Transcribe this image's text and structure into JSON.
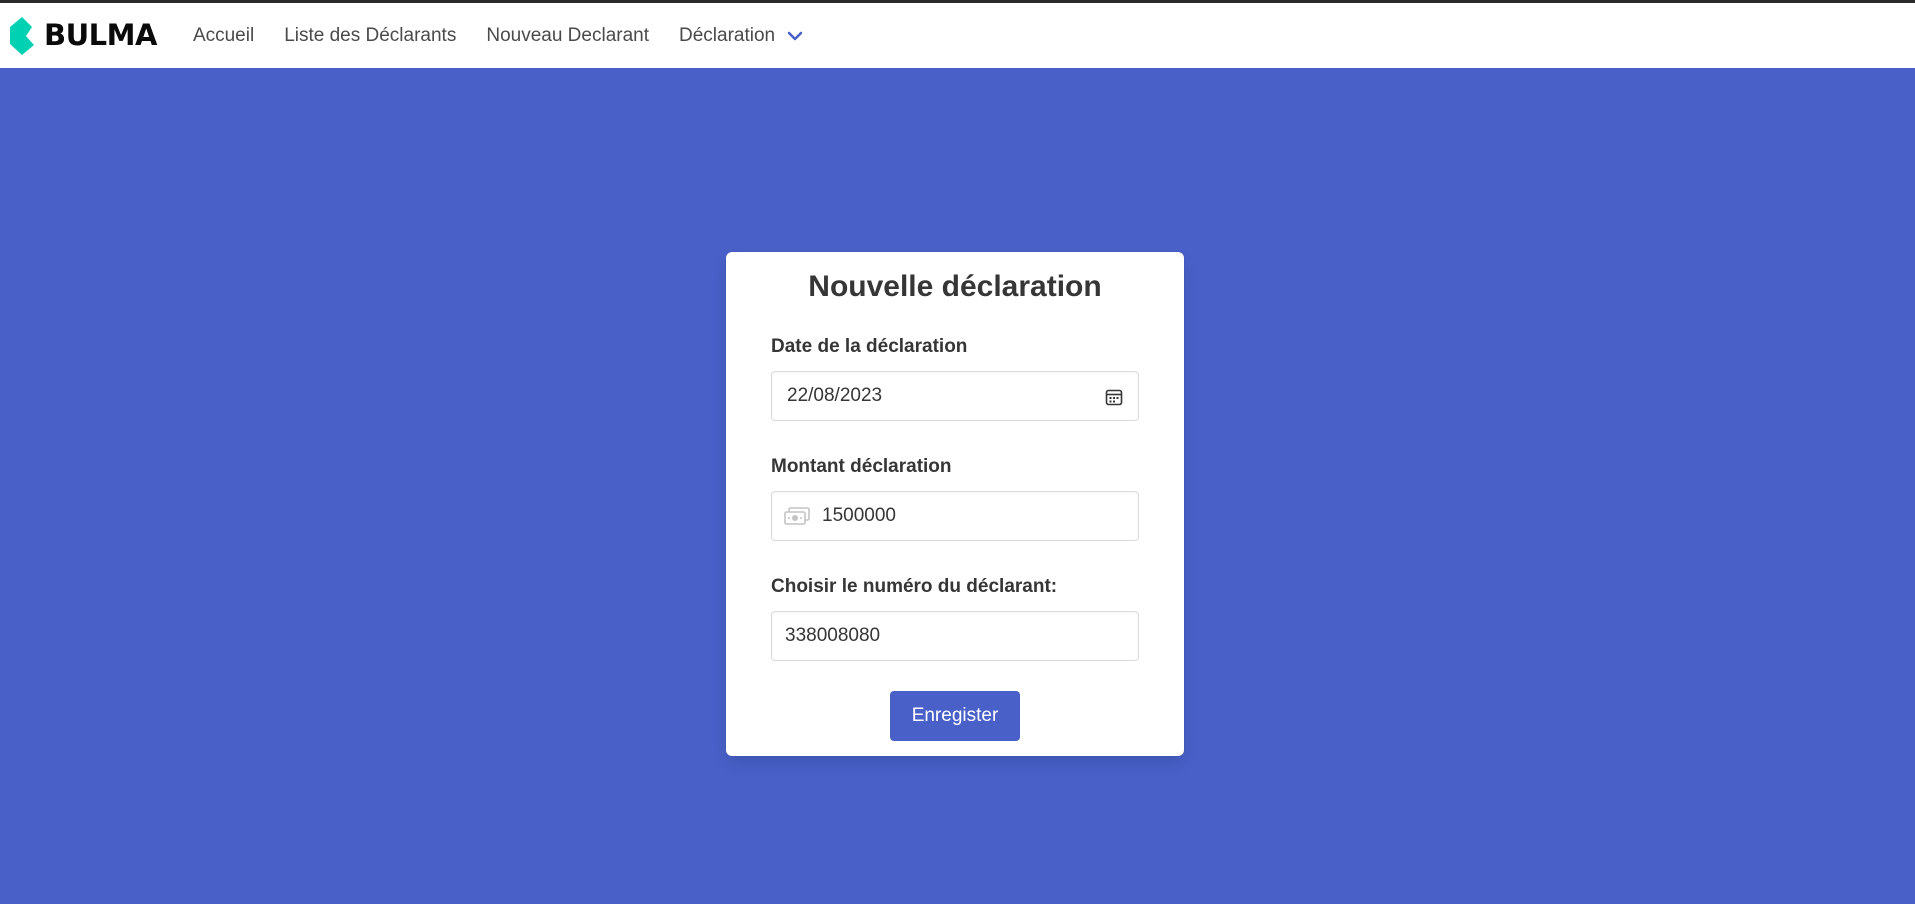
{
  "brand": {
    "name": "BULMA",
    "mark_color": "#00d1b2"
  },
  "nav": {
    "items": [
      {
        "label": "Accueil"
      },
      {
        "label": "Liste des Déclarants"
      },
      {
        "label": "Nouveau Declarant"
      }
    ],
    "dropdown": {
      "label": "Déclaration",
      "icon": "chevron-down-icon"
    }
  },
  "form": {
    "title": "Nouvelle déclaration",
    "date": {
      "label": "Date de la déclaration",
      "value": "22/08/2023",
      "icon": "calendar-icon"
    },
    "amount": {
      "label": "Montant déclaration",
      "value": "1500000",
      "icon": "money-icon"
    },
    "declarant": {
      "label": "Choisir le numéro du déclarant:",
      "value": "338008080"
    },
    "submit_label": "Enregister"
  },
  "colors": {
    "background": "#4860c8",
    "button": "#4860c8",
    "navbar": "#ffffff"
  }
}
